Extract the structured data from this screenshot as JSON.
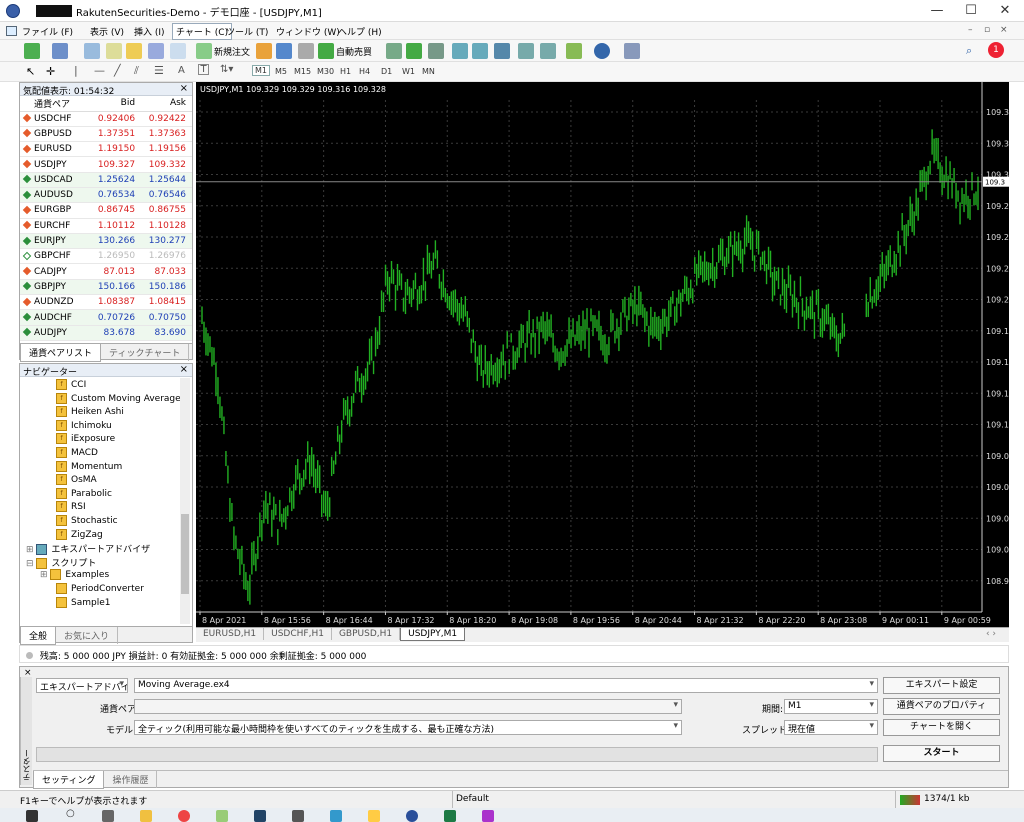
{
  "window": {
    "title": "RakutenSecurities-Demo - デモ口座 - [USDJPY,M1]",
    "minimize": "—",
    "maximize": "☐",
    "close": "✕"
  },
  "menu": [
    "ファイル (F)",
    "表示 (V)",
    "挿入 (I)",
    "チャート (C)",
    "ツール (T)",
    "ウィンドウ (W)",
    "ヘルプ (H)"
  ],
  "toolbar": {
    "new_order": "新規注文",
    "autotrade": "自動売買",
    "notification_count": "1"
  },
  "timeframes": [
    "M1",
    "M5",
    "M15",
    "M30",
    "H1",
    "H4",
    "D1",
    "W1",
    "MN"
  ],
  "market_watch": {
    "title": "気配値表示: 01:54:32",
    "headers": [
      "通貨ペア",
      "Bid",
      "Ask"
    ],
    "rows": [
      {
        "sym": "USDCHF",
        "bid": "0.92406",
        "ask": "0.92422",
        "dir": "up"
      },
      {
        "sym": "GBPUSD",
        "bid": "1.37351",
        "ask": "1.37363",
        "dir": "up"
      },
      {
        "sym": "EURUSD",
        "bid": "1.19150",
        "ask": "1.19156",
        "dir": "up"
      },
      {
        "sym": "USDJPY",
        "bid": "109.327",
        "ask": "109.332",
        "dir": "up"
      },
      {
        "sym": "USDCAD",
        "bid": "1.25624",
        "ask": "1.25644",
        "dir": "dn"
      },
      {
        "sym": "AUDUSD",
        "bid": "0.76534",
        "ask": "0.76546",
        "dir": "dn"
      },
      {
        "sym": "EURGBP",
        "bid": "0.86745",
        "ask": "0.86755",
        "dir": "up"
      },
      {
        "sym": "EURCHF",
        "bid": "1.10112",
        "ask": "1.10128",
        "dir": "up"
      },
      {
        "sym": "EURJPY",
        "bid": "130.266",
        "ask": "130.277",
        "dir": "dn"
      },
      {
        "sym": "GBPCHF",
        "bid": "1.26950",
        "ask": "1.26976",
        "dir": "nt"
      },
      {
        "sym": "CADJPY",
        "bid": "87.013",
        "ask": "87.033",
        "dir": "up"
      },
      {
        "sym": "GBPJPY",
        "bid": "150.166",
        "ask": "150.186",
        "dir": "dn"
      },
      {
        "sym": "AUDNZD",
        "bid": "1.08387",
        "ask": "1.08415",
        "dir": "up"
      },
      {
        "sym": "AUDCHF",
        "bid": "0.70726",
        "ask": "0.70750",
        "dir": "dn"
      },
      {
        "sym": "AUDJPY",
        "bid": "83.678",
        "ask": "83.690",
        "dir": "dn"
      }
    ],
    "tabs": [
      "通貨ペアリスト",
      "ティックチャート"
    ]
  },
  "navigator": {
    "title": "ナビゲーター",
    "indicators": [
      "CCI",
      "Custom Moving Averages",
      "Heiken Ashi",
      "Ichimoku",
      "iExposure",
      "MACD",
      "Momentum",
      "OsMA",
      "Parabolic",
      "RSI",
      "Stochastic",
      "ZigZag"
    ],
    "expert_advisors": "エキスパートアドバイザ",
    "scripts": "スクリプト",
    "script_items": [
      "Examples",
      "PeriodConverter",
      "Sample1"
    ],
    "tabs": [
      "全般",
      "お気に入り"
    ]
  },
  "chart_data": {
    "type": "bar",
    "title": "USDJPY,M1  109.329 109.329 109.316 109.328",
    "current_price_label": "109.3",
    "y_ticks": [
      "109.3",
      "109.3",
      "109.3",
      "109.2",
      "109.2",
      "109.2",
      "109.2",
      "109.1",
      "109.1",
      "109.1",
      "109.1",
      "109.0",
      "109.0",
      "109.0",
      "109.0",
      "108.9"
    ],
    "x_ticks": [
      "8 Apr 2021",
      "8 Apr 15:56",
      "8 Apr 16:44",
      "8 Apr 17:32",
      "8 Apr 18:20",
      "8 Apr 19:08",
      "8 Apr 19:56",
      "8 Apr 20:44",
      "8 Apr 21:32",
      "8 Apr 22:20",
      "8 Apr 23:08",
      "9 Apr 00:11",
      "9 Apr 00:59"
    ],
    "ylim": [
      108.93,
      109.4
    ],
    "grid": true,
    "profile": [
      [
        0,
        109.2
      ],
      [
        0.02,
        109.15
      ],
      [
        0.04,
        109.0
      ],
      [
        0.06,
        108.95
      ],
      [
        0.08,
        109.03
      ],
      [
        0.1,
        109.01
      ],
      [
        0.12,
        109.05
      ],
      [
        0.14,
        109.07
      ],
      [
        0.16,
        109.02
      ],
      [
        0.18,
        109.1
      ],
      [
        0.2,
        109.14
      ],
      [
        0.22,
        109.16
      ],
      [
        0.24,
        109.24
      ],
      [
        0.26,
        109.22
      ],
      [
        0.28,
        109.23
      ],
      [
        0.3,
        109.25
      ],
      [
        0.32,
        109.22
      ],
      [
        0.34,
        109.2
      ],
      [
        0.36,
        109.15
      ],
      [
        0.38,
        109.16
      ],
      [
        0.4,
        109.17
      ],
      [
        0.42,
        109.18
      ],
      [
        0.44,
        109.19
      ],
      [
        0.46,
        109.17
      ],
      [
        0.48,
        109.18
      ],
      [
        0.5,
        109.19
      ],
      [
        0.52,
        109.18
      ],
      [
        0.54,
        109.2
      ],
      [
        0.56,
        109.21
      ],
      [
        0.58,
        109.19
      ],
      [
        0.6,
        109.2
      ],
      [
        0.62,
        109.22
      ],
      [
        0.64,
        109.24
      ],
      [
        0.66,
        109.25
      ],
      [
        0.68,
        109.26
      ],
      [
        0.7,
        109.27
      ],
      [
        0.72,
        109.26
      ],
      [
        0.74,
        109.23
      ],
      [
        0.76,
        109.22
      ],
      [
        0.78,
        109.21
      ],
      [
        0.8,
        109.2
      ],
      [
        0.82,
        109.18
      ],
      [
        0.84,
        109.2
      ],
      [
        0.86,
        109.22
      ],
      [
        0.88,
        109.24
      ],
      [
        0.9,
        109.27
      ],
      [
        0.92,
        109.3
      ],
      [
        0.94,
        109.35
      ],
      [
        0.96,
        109.33
      ],
      [
        0.98,
        109.31
      ],
      [
        1.0,
        109.32
      ]
    ],
    "color": "#22b022"
  },
  "chart_tabs": [
    "EURUSD,H1",
    "USDCHF,H1",
    "GBPUSD,H1",
    "USDJPY,M1"
  ],
  "account": "残高: 5 000 000 JPY  損益計: 0  有効証拠金: 5 000 000  余剰証拠金: 5 000 000",
  "tester": {
    "side_label": "テスター",
    "type": "エキスパートアドバイザ",
    "ea": "Moving Average.ex4",
    "symbol_label": "通貨ペア:",
    "symbol": "",
    "model_label": "モデル:",
    "model": "全ティック(利用可能な最小時間枠を使いすべてのティックを生成する、最も正確な方法)",
    "period_label": "期間:",
    "period": "M1",
    "spread_label": "スプレッド:",
    "spread": "現在値",
    "btn_settings": "エキスパート設定",
    "btn_props": "通貨ペアのプロパティ",
    "btn_open_chart": "チャートを開く",
    "btn_start": "スタート",
    "tabs": [
      "セッティング",
      "操作履歴"
    ]
  },
  "status": {
    "help": "F1キーでヘルプが表示されます",
    "profile": "Default",
    "traffic": "1374/1 kb"
  }
}
